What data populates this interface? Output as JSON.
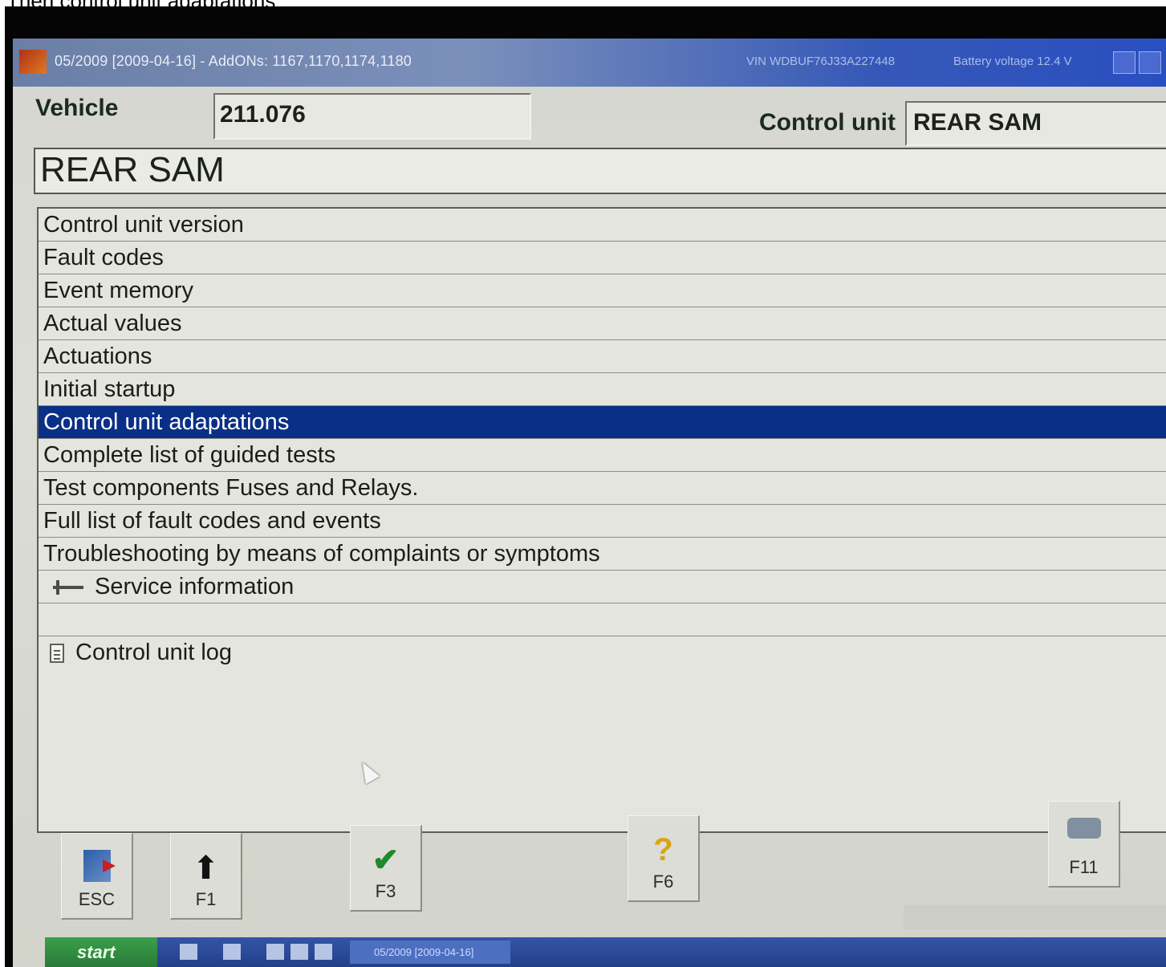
{
  "caption": "Then control unit adaptations",
  "window": {
    "title": "05/2009 [2009-04-16] - AddONs: 1167,1170,1174,1180",
    "vin": "VIN  WDBUF76J33A227448",
    "battery": "Battery voltage  12.4 V"
  },
  "vehicle": {
    "label": "Vehicle",
    "value": "211.076"
  },
  "control_unit": {
    "label": "Control unit",
    "value": "REAR SAM"
  },
  "header": {
    "title": "REAR SAM"
  },
  "menu": {
    "items": [
      {
        "label": "Control unit version"
      },
      {
        "label": "Fault codes"
      },
      {
        "label": "Event memory"
      },
      {
        "label": "Actual values"
      },
      {
        "label": "Actuations"
      },
      {
        "label": "Initial startup"
      },
      {
        "label": "Control unit adaptations",
        "selected": true
      },
      {
        "label": "Complete list of guided tests"
      },
      {
        "label": "Test components Fuses and Relays."
      },
      {
        "label": "Full list of fault codes and events"
      },
      {
        "label": "Troubleshooting by means of complaints or symptoms"
      },
      {
        "label": "Service information",
        "icon": "plug-icon"
      },
      {
        "label": ""
      },
      {
        "label": "Control unit log",
        "icon": "document-icon"
      }
    ],
    "selected_color": "#0a2f86"
  },
  "function_keys": [
    {
      "label": "ESC",
      "icon": "exit-door-icon"
    },
    {
      "label": "F1",
      "icon": "up-arrow-icon"
    },
    {
      "label": "F3",
      "icon": "checkmark-icon"
    },
    {
      "label": "F6",
      "icon": "help-question-icon"
    },
    {
      "label": "F11",
      "icon": "printer-icon"
    }
  ],
  "taskbar": {
    "start_label": "start",
    "task_label": "05/2009 [2009-04-16]"
  }
}
